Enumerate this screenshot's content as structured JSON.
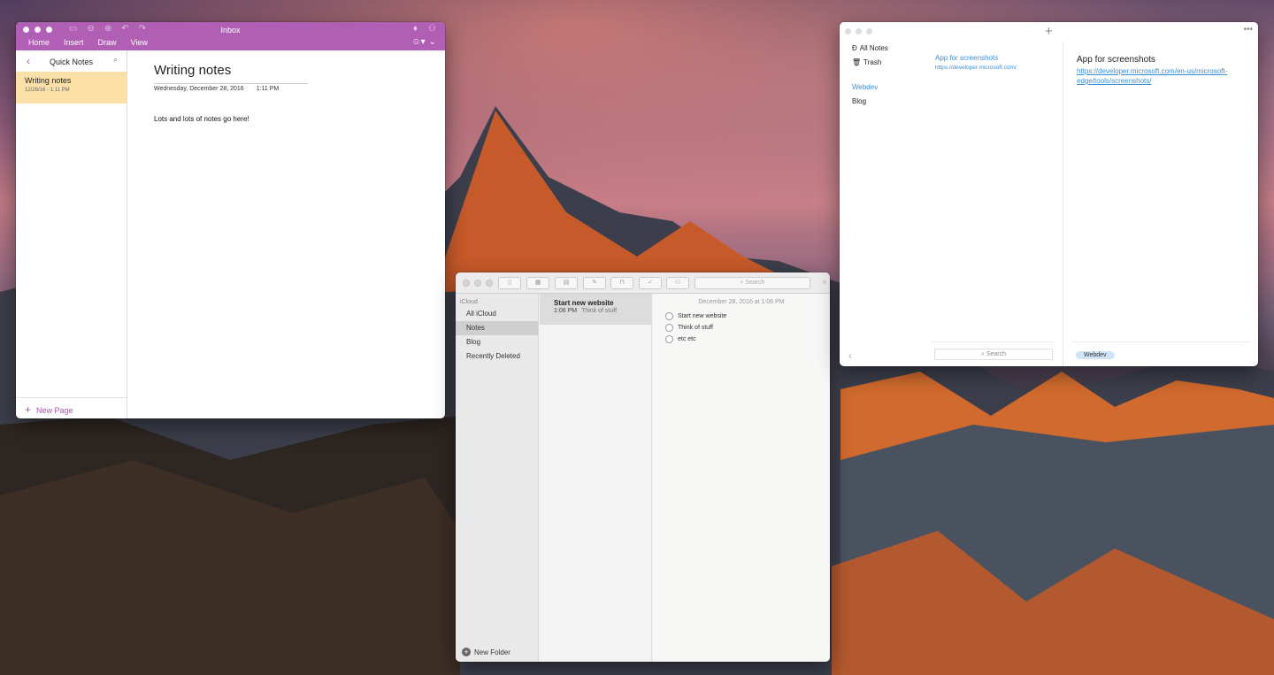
{
  "desktop": {
    "wallpaper": "mountain-sunset"
  },
  "onenote": {
    "window_title": "Inbox",
    "ribbon_tabs": [
      "Home",
      "Insert",
      "Draw",
      "View"
    ],
    "sidebar_title": "Quick Notes",
    "page_item": {
      "title": "Writing notes",
      "date": "12/28/16 - 1:11 PM"
    },
    "new_page_label": "New Page",
    "page": {
      "title": "Writing notes",
      "date": "Wednesday, December 28, 2016",
      "time": "1:11 PM",
      "body": "Lots and lots of notes go here!"
    },
    "accent_color": "#b05fb5"
  },
  "apple_notes": {
    "toolbar": {
      "search_placeholder": "Search"
    },
    "account": "iCloud",
    "folders": [
      {
        "label": "All iCloud",
        "selected": false
      },
      {
        "label": "Notes",
        "selected": true
      },
      {
        "label": "Blog",
        "selected": false
      },
      {
        "label": "Recently Deleted",
        "selected": false
      }
    ],
    "new_folder_label": "New Folder",
    "selected_note": {
      "title": "Start new website",
      "time": "1:06 PM",
      "preview": "Think of stuff"
    },
    "editor": {
      "date": "December 28, 2016 at 1:06 PM",
      "checklist": [
        "Start new website",
        "Think of stuff",
        "etc etc"
      ]
    }
  },
  "simplenote": {
    "nav": {
      "all_notes": "All Notes",
      "trash": "Trash",
      "tags": [
        "Webdev",
        "Blog"
      ]
    },
    "list": {
      "note_title": "App for screenshots",
      "note_url": "https://developer.microsoft.com/",
      "search_placeholder": "Search"
    },
    "detail": {
      "title": "App for screenshots",
      "link": "https://developer.microsoft.com/en-us/microsoft-edge/tools/screenshots/",
      "tag": "Webdev"
    },
    "accent_color": "#3a8ed6"
  }
}
